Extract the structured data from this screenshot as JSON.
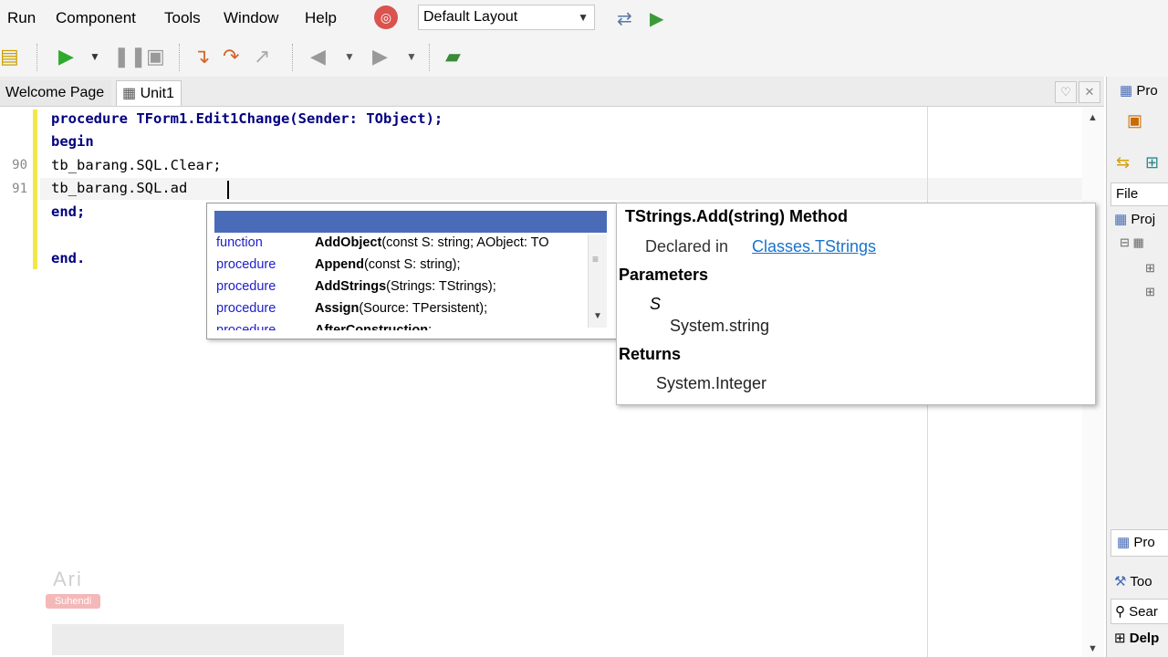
{
  "menu": {
    "items": [
      "Run",
      "Component",
      "Tools",
      "Window",
      "Help"
    ],
    "layout_value": "Default Layout"
  },
  "toolbar": {
    "icons": [
      "open-project-icon",
      "run-icon",
      "run-dropdown-icon",
      "pause-icon",
      "stop-icon",
      "step-into-icon",
      "step-over-icon",
      "run-to-cursor-icon",
      "back-icon",
      "back-dropdown-icon",
      "forward-icon",
      "forward-dropdown-icon",
      "help-book-icon"
    ]
  },
  "tabs": [
    {
      "label": "Welcome Page",
      "active": false
    },
    {
      "label": "Unit1",
      "active": true
    }
  ],
  "editor": {
    "lines": [
      {
        "number": "",
        "text": "procedure TForm1.Edit1Change(Sender: TObject);"
      },
      {
        "number": "",
        "text": "begin"
      },
      {
        "number": "90",
        "text": "tb_barang.SQL.Clear;"
      },
      {
        "number": "91",
        "text": "tb_barang.SQL.ad"
      },
      {
        "number": "",
        "text": "end;"
      },
      {
        "number": "",
        "text": ""
      },
      {
        "number": "",
        "text": "end."
      }
    ]
  },
  "completion": {
    "items": [
      {
        "kind": "function",
        "name": "AddObject",
        "params": "(const S: string; AObject: TO"
      },
      {
        "kind": "procedure",
        "name": "Append",
        "params": "(const S: string);"
      },
      {
        "kind": "procedure",
        "name": "AddStrings",
        "params": "(Strings: TStrings);"
      },
      {
        "kind": "procedure",
        "name": "Assign",
        "params": "(Source: TPersistent);"
      },
      {
        "kind": "procedure",
        "name": "AfterConstruction",
        "params": ";"
      }
    ]
  },
  "help": {
    "title": "TStrings.Add(string) Method",
    "declared_prefix": "Declared in",
    "declared_link": "Classes.TStrings",
    "parameters_heading": "Parameters",
    "param_name": "S",
    "param_type": "System.string",
    "returns_heading": "Returns",
    "returns_type": "System.Integer"
  },
  "right_panel": {
    "top_label": "Pro",
    "file_header": "File",
    "project_label": "Proj",
    "project_tab": "Pro",
    "tool_palette": "Too",
    "search": "Sear",
    "delphi": "Delp"
  },
  "watermark": {
    "name": "Ari",
    "sub": "Suhendi"
  },
  "colors": {
    "keyword": "#000080",
    "completion_kind": "#1d1dcc",
    "completion_header": "#4a6cb8",
    "change_bar": "#f2e84a",
    "link": "#1a73c9"
  }
}
